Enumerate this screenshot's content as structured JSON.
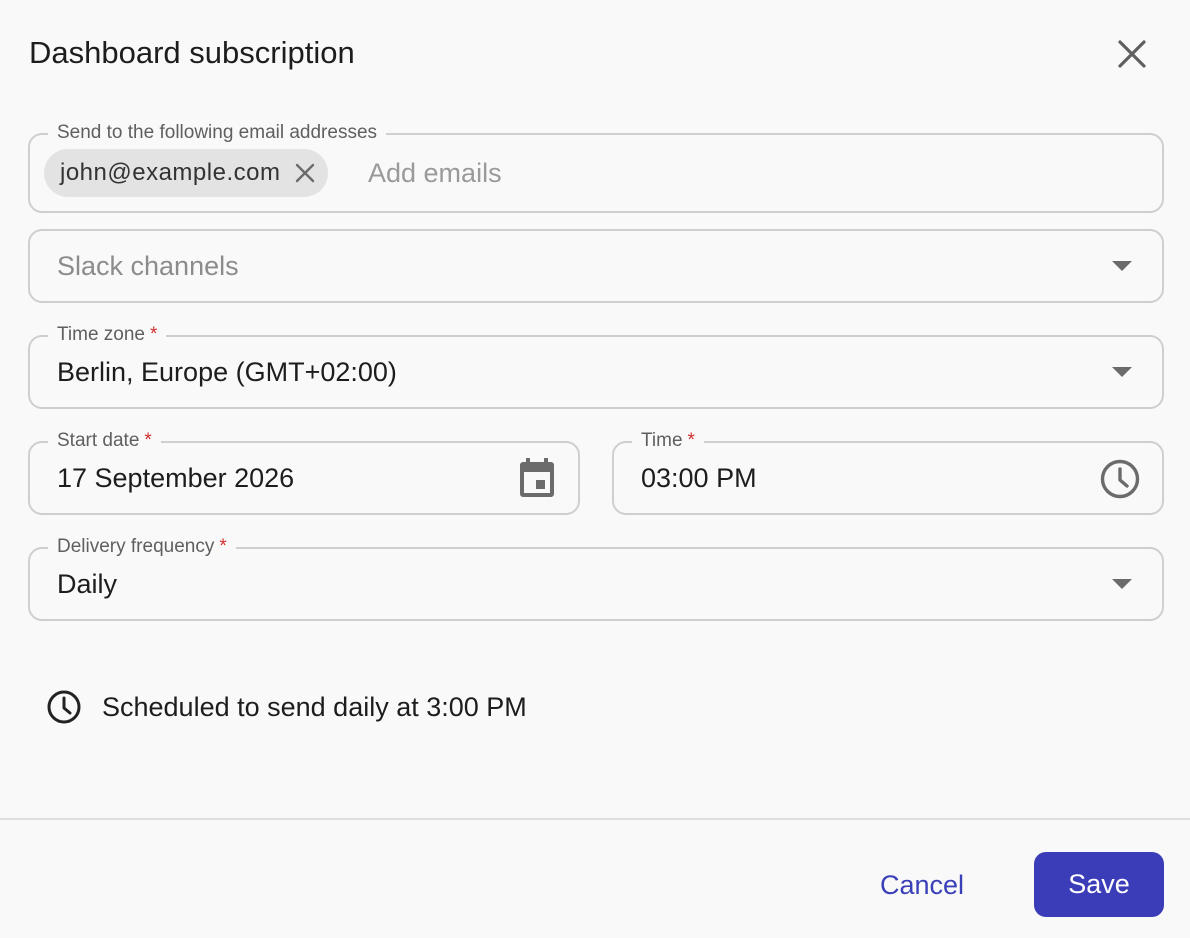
{
  "dialog": {
    "title": "Dashboard subscription",
    "close_icon": "close-icon"
  },
  "emails": {
    "label": "Send to the following email addresses",
    "chips": [
      "john@example.com"
    ],
    "input_placeholder": "Add emails",
    "input_value": ""
  },
  "slack": {
    "placeholder": "Slack channels"
  },
  "timezone": {
    "label": "Time zone",
    "required_mark": "*",
    "value": "Berlin, Europe (GMT+02:00)"
  },
  "start_date": {
    "label": "Start date",
    "required_mark": "*",
    "value": "17 September 2026",
    "icon": "calendar-icon"
  },
  "time": {
    "label": "Time",
    "required_mark": "*",
    "value": "03:00 PM",
    "icon": "clock-icon"
  },
  "frequency": {
    "label": "Delivery frequency",
    "required_mark": "*",
    "value": "Daily"
  },
  "schedule_summary": {
    "icon": "clock-icon",
    "text": "Scheduled to send daily at 3:00 PM"
  },
  "actions": {
    "cancel_label": "Cancel",
    "save_label": "Save"
  },
  "colors": {
    "primary": "#3b3db8",
    "link": "#3940b8",
    "required": "#d32f2f",
    "border": "#cfcfcf",
    "background": "#f9f9f9"
  }
}
